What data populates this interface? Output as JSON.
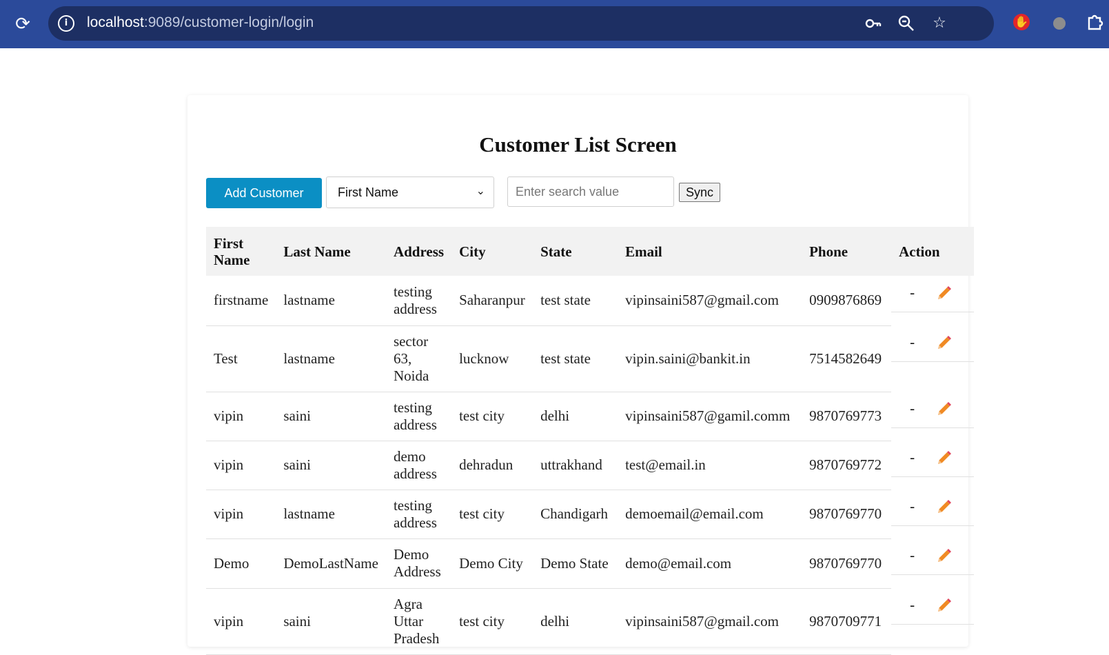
{
  "browser": {
    "url_host": "localhost",
    "url_path": ":9089/customer-login/login"
  },
  "page": {
    "title": "Customer List Screen",
    "add_button": "Add Customer",
    "filter_select": "First Name",
    "search_placeholder": "Enter search value",
    "sync_button": "Sync"
  },
  "table": {
    "headers": [
      "First Name",
      "Last Name",
      "Address",
      "City",
      "State",
      "Email",
      "Phone",
      "Action"
    ],
    "rows": [
      {
        "first": "firstname",
        "last": "lastname",
        "address": "testing address",
        "city": "Saharanpur",
        "state": "test state",
        "email": "vipinsaini587@gmail.com",
        "phone": "0909876869",
        "action": "-"
      },
      {
        "first": "Test",
        "last": "lastname",
        "address": "sector 63, Noida",
        "city": "lucknow",
        "state": "test state",
        "email": "vipin.saini@bankit.in",
        "phone": "7514582649",
        "action": "-"
      },
      {
        "first": "vipin",
        "last": "saini",
        "address": "testing address",
        "city": "test city",
        "state": "delhi",
        "email": "vipinsaini587@gamil.comm",
        "phone": "9870769773",
        "action": "-"
      },
      {
        "first": "vipin",
        "last": "saini",
        "address": "demo address",
        "city": "dehradun",
        "state": "uttrakhand",
        "email": "test@email.in",
        "phone": "9870769772",
        "action": "-"
      },
      {
        "first": "vipin",
        "last": "lastname",
        "address": "testing address",
        "city": "test city",
        "state": "Chandigarh",
        "email": "demoemail@email.com",
        "phone": "9870769770",
        "action": "-"
      },
      {
        "first": "Demo",
        "last": "DemoLastName",
        "address": "Demo Address",
        "city": "Demo City",
        "state": "Demo State",
        "email": "demo@email.com",
        "phone": "9870769770",
        "action": "-"
      },
      {
        "first": "vipin",
        "last": "saini",
        "address": "Agra Uttar Pradesh",
        "city": "test city",
        "state": "delhi",
        "email": "vipinsaini587@gmail.com",
        "phone": "9870709771",
        "action": "-"
      }
    ]
  },
  "icons": {
    "edit": "pencil-icon",
    "reload": "reload-icon",
    "site_info": "info-icon",
    "password": "key-icon",
    "zoom": "zoom-icon",
    "bookmark": "star-icon",
    "extensions": "puzzle-icon"
  },
  "colors": {
    "chrome": "#2b4a9a",
    "add_button": "#0b8fc4",
    "pencil": "#f08a24"
  }
}
